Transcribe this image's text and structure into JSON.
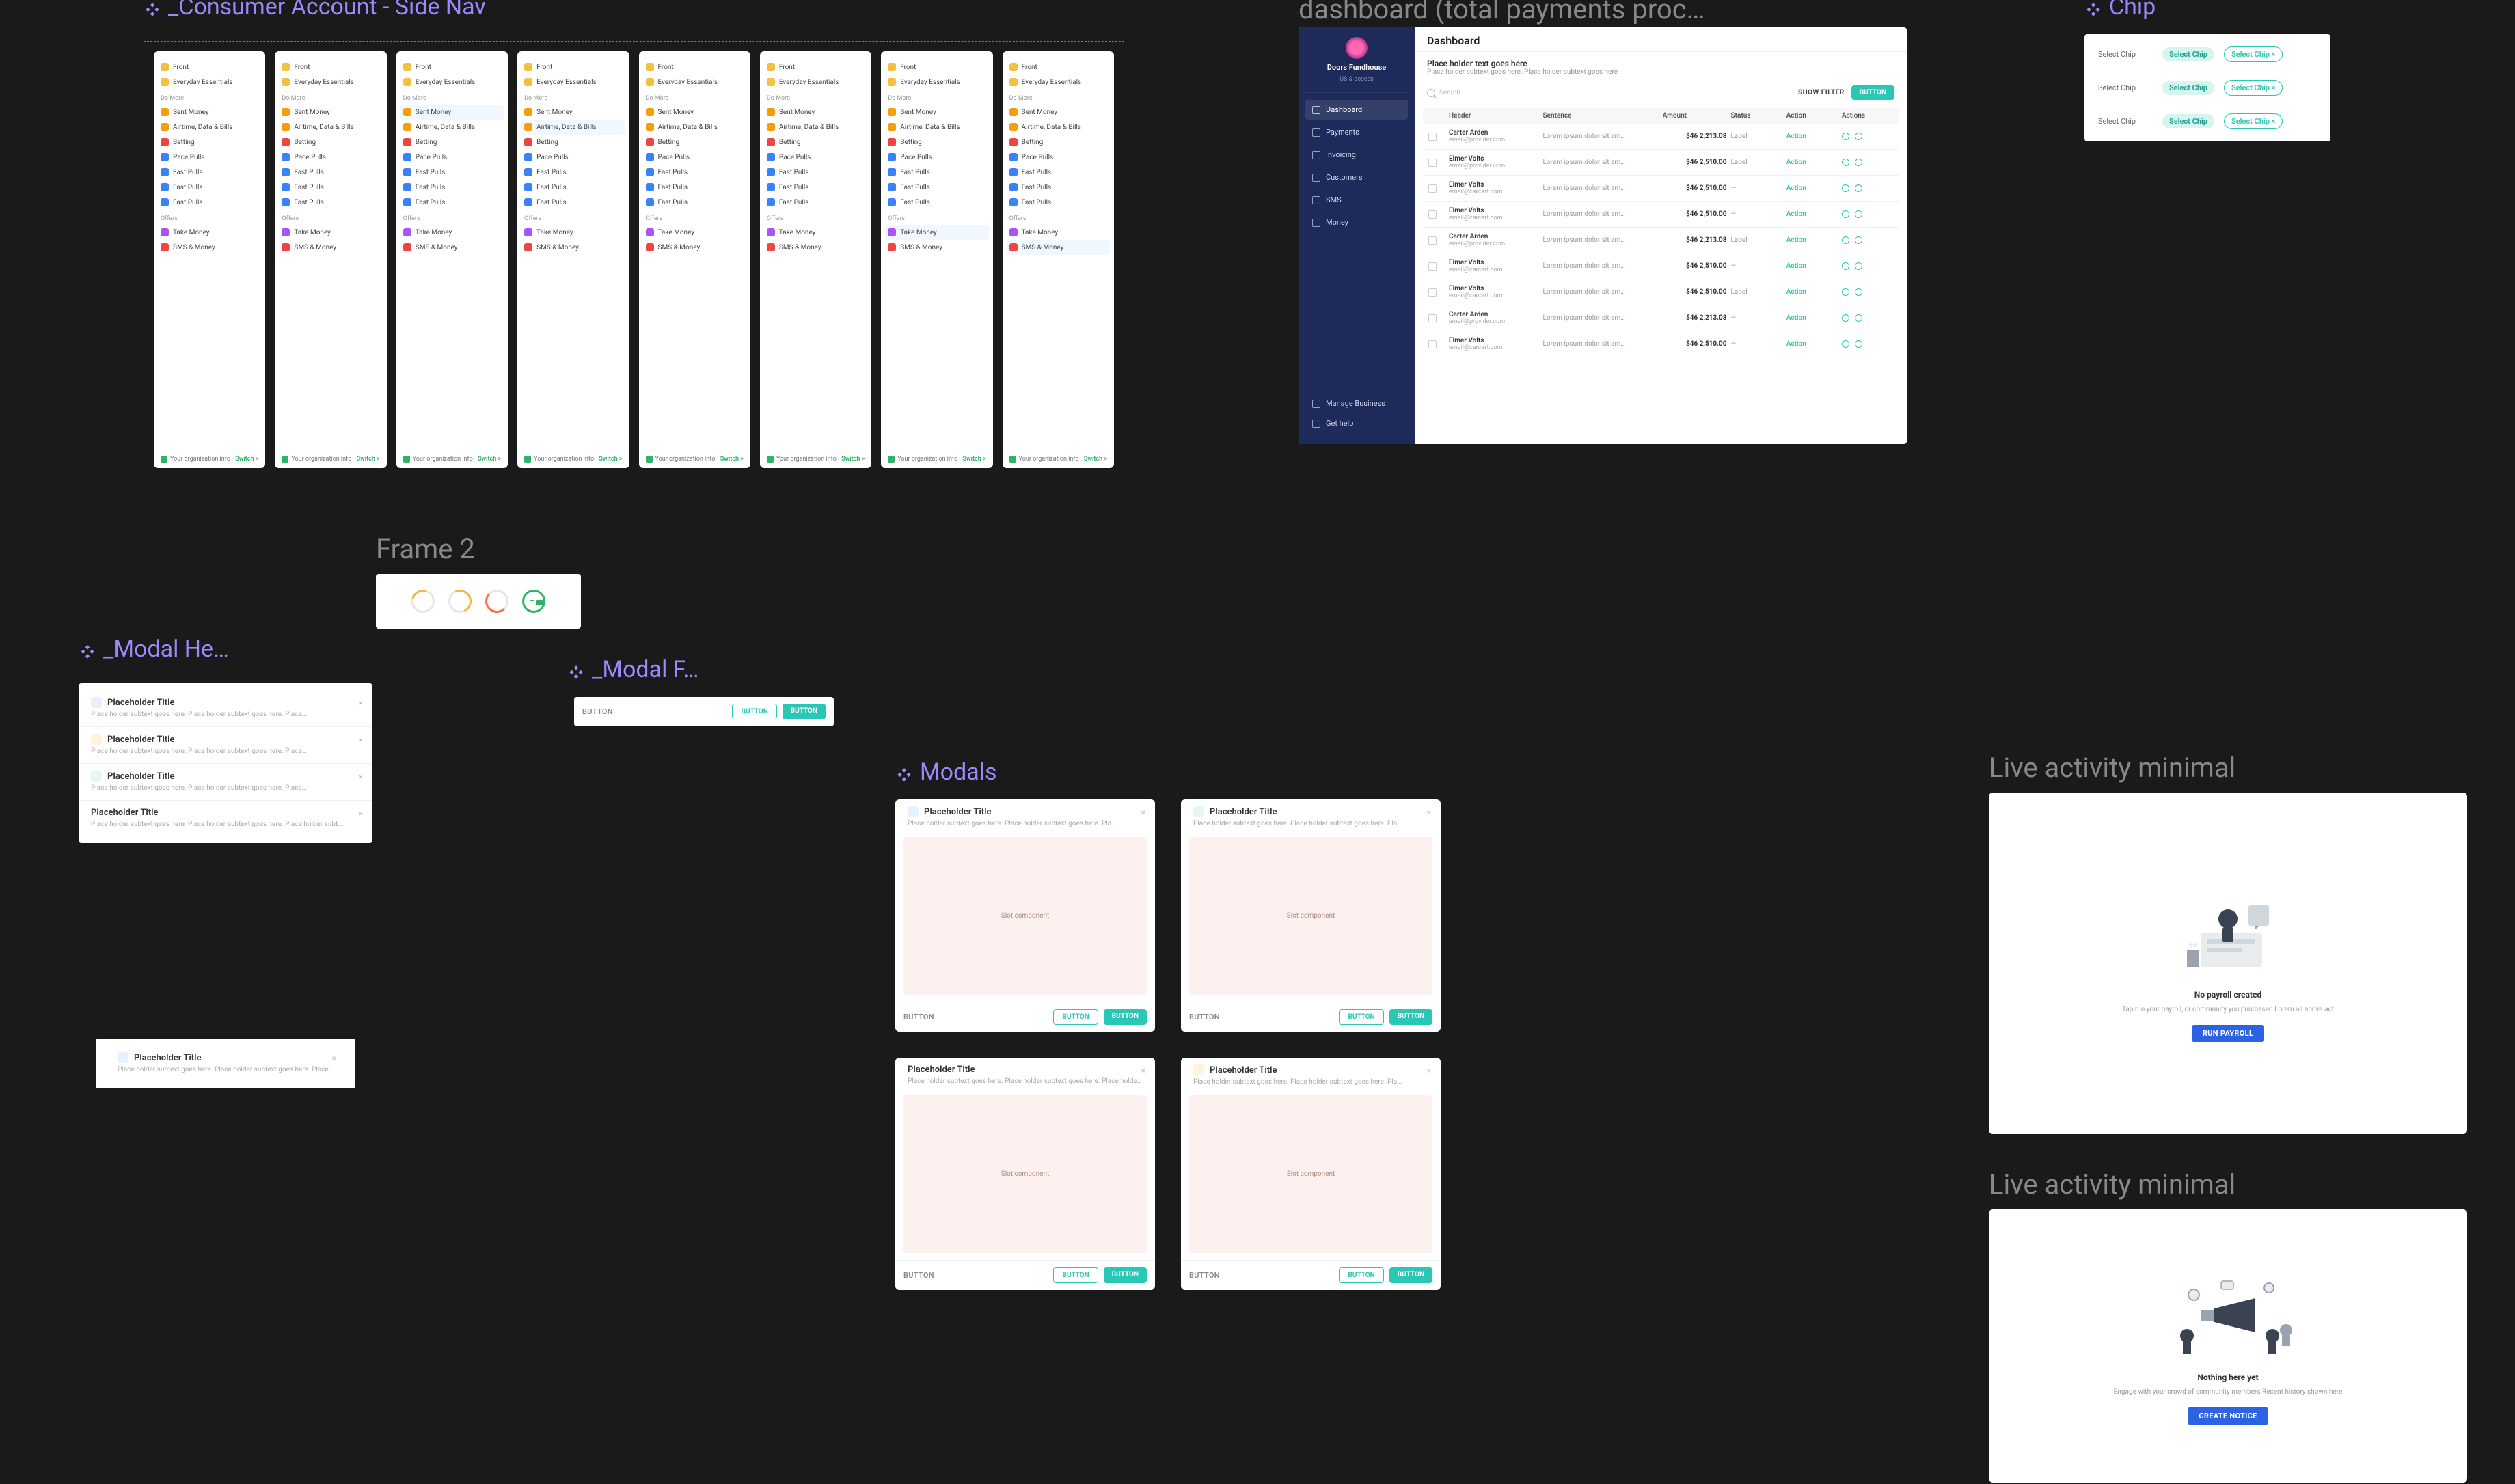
{
  "labels": {
    "consumer": "_Consumer Account - Side Nav",
    "dashboard": "dashboard (total payments proc…",
    "chip": "Chip",
    "frame2": "Frame 2",
    "modal_header": "_Modal He…",
    "modal_footer": "_Modal F…",
    "modals": "Modals",
    "live1": "Live activity minimal",
    "live2": "Live activity minimal"
  },
  "sidenav": {
    "sections": [
      {
        "label": "",
        "items": [
          {
            "icon": "#f3c042",
            "text": "Front"
          },
          {
            "icon": "#f3c042",
            "text": "Everyday Essentials"
          }
        ]
      },
      {
        "label": "Do More",
        "items": [
          {
            "icon": "#f59e0b",
            "text": "Sent Money"
          },
          {
            "icon": "#f59e0b",
            "text": "Airtime, Data & Bills"
          },
          {
            "icon": "#ef4444",
            "text": "Betting"
          },
          {
            "icon": "#3b82f6",
            "text": "Pace Pulls"
          },
          {
            "icon": "#3b82f6",
            "text": "Fast Pulls"
          },
          {
            "icon": "#3b82f6",
            "text": "Fast Pulls"
          },
          {
            "icon": "#3b82f6",
            "text": "Fast Pulls"
          }
        ]
      },
      {
        "label": "Offers",
        "items": [
          {
            "icon": "#a855f7",
            "text": "Take Money"
          },
          {
            "icon": "#ef4444",
            "text": "SMS & Money"
          }
        ]
      }
    ],
    "footer_left": "Your organization info",
    "footer_right": "Switch >"
  },
  "dashboard": {
    "brand": "Doors Fundhouse",
    "sublabel": "US & access",
    "title": "Dashboard",
    "heading": "Place holder text goes here",
    "sub": "Place holder subtext goes here. Place holder subtext goes here",
    "search": "Search",
    "show": "SHOW FILTER",
    "button": "BUTTON",
    "nav": [
      "Dashboard",
      "Payments",
      "Invoicing",
      "Customers",
      "SMS",
      "Money"
    ],
    "bottom_nav": [
      "Manage Business",
      "Get help"
    ],
    "columns": [
      "",
      "Header",
      "Sentence",
      "Amount",
      "Status",
      "Action",
      "Actions"
    ],
    "rows": [
      {
        "name": "Carter Arden",
        "email": "email@provider.com",
        "sent": "Lorem ipsum dolor sit am…",
        "amt": "$46 2,213.08",
        "date": "",
        "status": "Label",
        "action": "Action"
      },
      {
        "name": "Elmer Volts",
        "email": "email@provider.com",
        "sent": "Lorem ipsum dolor sit am…",
        "amt": "$46 2,510.00",
        "date": "",
        "status": "Label",
        "action": "Action"
      },
      {
        "name": "Elmer Volts",
        "email": "email@carcart.com",
        "sent": "Lorem ipsum dolor sit am…",
        "amt": "$46 2,510.00",
        "date": "",
        "status": "—",
        "action": "Action"
      },
      {
        "name": "Elmer Volts",
        "email": "email@carcart.com",
        "sent": "Lorem ipsum dolor sit am…",
        "amt": "$46 2,510.00",
        "date": "",
        "status": "—",
        "action": "Action"
      },
      {
        "name": "Carter Arden",
        "email": "email@provider.com",
        "sent": "Lorem ipsum dolor sit am…",
        "amt": "$46 2,213.08",
        "date": "",
        "status": "Label",
        "action": "Action"
      },
      {
        "name": "Elmer Volts",
        "email": "email@carcart.com",
        "sent": "Lorem ipsum dolor sit am…",
        "amt": "$46 2,510.00",
        "date": "",
        "status": "—",
        "action": "Action"
      },
      {
        "name": "Elmer Volts",
        "email": "email@carcart.com",
        "sent": "Lorem ipsum dolor sit am…",
        "amt": "$46 2,510.00",
        "date": "",
        "status": "Label",
        "action": "Action"
      },
      {
        "name": "Carter Arden",
        "email": "email@provider.com",
        "sent": "Lorem ipsum dolor sit am…",
        "amt": "$46 2,213.08",
        "date": "",
        "status": "—",
        "action": "Action"
      },
      {
        "name": "Elmer Volts",
        "email": "email@carcart.com",
        "sent": "Lorem ipsum dolor sit am…",
        "amt": "$46 2,510.00",
        "date": "",
        "status": "—",
        "action": "Action"
      }
    ]
  },
  "chips": {
    "rows": [
      {
        "label": "Select Chip",
        "chips": [
          {
            "text": "Select Chip",
            "variant": "solid"
          },
          {
            "text": "Select Chip ×",
            "variant": "outline"
          }
        ]
      },
      {
        "label": "Select Chip",
        "chips": [
          {
            "text": "Select Chip",
            "variant": "solid"
          },
          {
            "text": "Select Chip ×",
            "variant": "outline"
          }
        ]
      },
      {
        "label": "Select Chip",
        "chips": [
          {
            "text": "Select Chip",
            "variant": "solid"
          },
          {
            "text": "Select Chip ×",
            "variant": "outline"
          }
        ]
      }
    ]
  },
  "modal_header_items": [
    {
      "icon": "blue",
      "title": "Placeholder Title",
      "sub": "Place holder subtext goes here. Place holder subtext goes here. Place…"
    },
    {
      "icon": "warn",
      "title": "Placeholder Title",
      "sub": "Place holder subtext goes here. Place holder subtext goes here. Place…"
    },
    {
      "icon": "green",
      "title": "Placeholder Title",
      "sub": "Place holder subtext goes here. Place holder subtext goes here. Place…"
    },
    {
      "icon": "",
      "title": "Placeholder Title",
      "sub": "Place holder subtext goes here. Place holder subtext goes here. Place holder subt…"
    }
  ],
  "modal_header_single": {
    "icon": "blue",
    "title": "Placeholder Title",
    "sub": "Place holder subtext goes here. Place holder subtext goes here. Place…"
  },
  "modal_footer": {
    "left": "BUTTON",
    "btn1": "BUTTON",
    "btn2": "BUTTON"
  },
  "modals": {
    "cards": [
      {
        "icon": "blue",
        "title": "Placeholder Title",
        "sub": "Place holder subtext goes here. Place holder subtext goes here. Pla…",
        "slot": "Slot component"
      },
      {
        "icon": "green",
        "title": "Placeholder Title",
        "sub": "Place holder subtext goes here. Place holder subtext goes here. Pla…",
        "slot": "Slot component"
      },
      {
        "icon": "",
        "title": "Placeholder Title",
        "sub": "Place holder subtext goes here. Place holder subtext goes here. Place holder…",
        "slot": "Slot component"
      },
      {
        "icon": "warn",
        "title": "Placeholder Title",
        "sub": "Place holder subtext goes here. Place holder subtext goes here. Pla…",
        "slot": "Slot component"
      }
    ],
    "footer_left": "BUTTON",
    "btn1": "BUTTON",
    "btn2": "BUTTON"
  },
  "live1": {
    "head": "No payroll created",
    "sub": "Tap run your payroll, or community you purchased\nLorem all above act",
    "btn": "RUN PAYROLL"
  },
  "live2": {
    "head": "Nothing here yet",
    "sub": "Engage with your crowd of community members\nRecent history shown here",
    "btn": "CREATE NOTICE"
  }
}
